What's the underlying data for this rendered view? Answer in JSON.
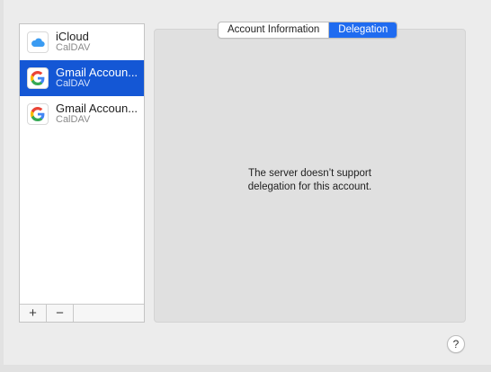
{
  "accounts": [
    {
      "name": "iCloud",
      "type": "CalDAV",
      "icon": "icloud-icon",
      "selected": false
    },
    {
      "name": "Gmail Accoun...",
      "type": "CalDAV",
      "icon": "google-icon",
      "selected": true
    },
    {
      "name": "Gmail Accoun...",
      "type": "CalDAV",
      "icon": "google-icon",
      "selected": false
    }
  ],
  "list_footer": {
    "add_label": "+",
    "remove_label": "−"
  },
  "tabs": [
    {
      "label": "Account Information",
      "active": false
    },
    {
      "label": "Delegation",
      "active": true
    }
  ],
  "panel": {
    "message_line1": "The server doesn’t support",
    "message_line2": "delegation for this account."
  },
  "help": {
    "label": "?"
  },
  "colors": {
    "selection": "#1457d5",
    "tab_active": "#1f6bf0",
    "icloud": "#3a9bf2"
  }
}
